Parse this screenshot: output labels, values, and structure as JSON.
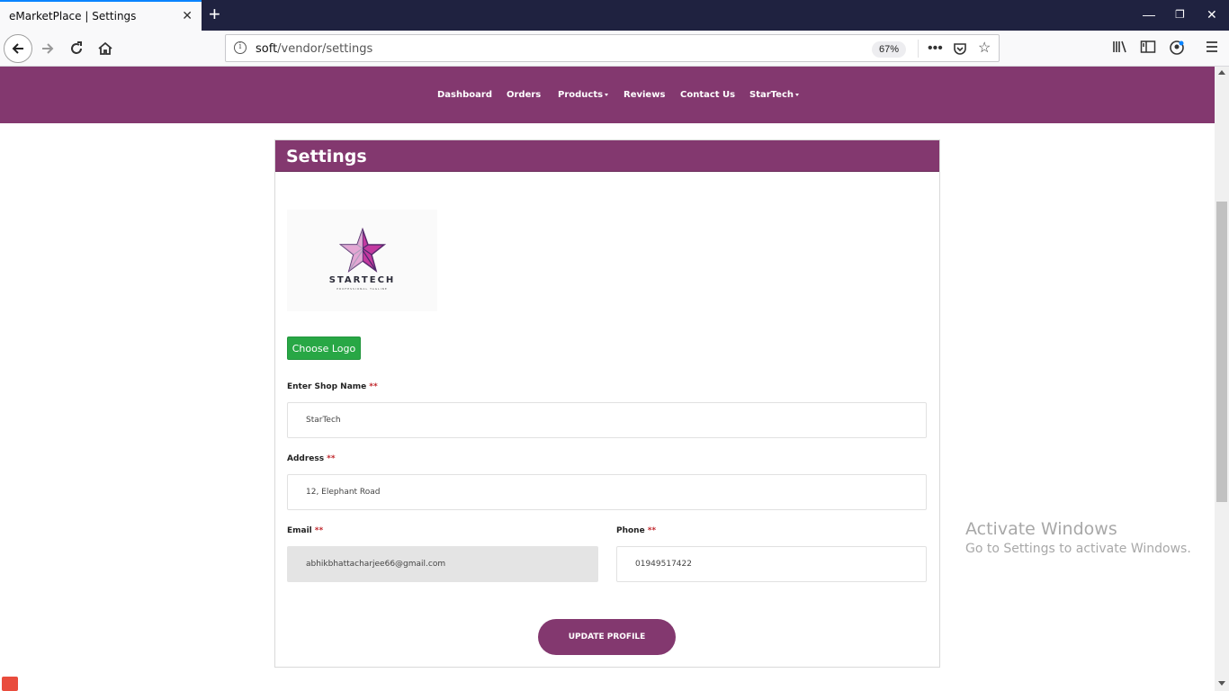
{
  "browser": {
    "tab_title": "eMarketPlace | Settings",
    "tab_close_icon": "close-icon",
    "new_tab_icon": "plus-icon",
    "url_host": "soft",
    "url_path": "/vendor/settings",
    "zoom": "67%"
  },
  "site_nav": {
    "items": [
      {
        "label": "Dashboard"
      },
      {
        "label": "Orders"
      },
      {
        "label": "Products"
      },
      {
        "label": "Reviews"
      },
      {
        "label": "Contact Us"
      },
      {
        "label": "StarTech"
      }
    ]
  },
  "settings": {
    "title": "Settings",
    "logo_text": "STARTECH",
    "logo_tagline": "PROFESSIONAL TAGLINE",
    "choose_logo_label": "Choose Logo",
    "required_mark": "**",
    "shop_name_label": "Enter Shop Name",
    "shop_name_value": "StarTech",
    "address_label": "Address",
    "address_value": "12, Elephant Road",
    "email_label": "Email",
    "email_value": "abhikbhattacharjee66@gmail.com",
    "phone_label": "Phone",
    "phone_value": "01949517422",
    "update_label": "UPDATE PROFILE"
  },
  "watermark": {
    "line1": "Activate Windows",
    "line2": "Go to Settings to activate Windows."
  },
  "colors": {
    "brand": "#83386f",
    "green": "#28a745",
    "required": "#c0262b"
  }
}
